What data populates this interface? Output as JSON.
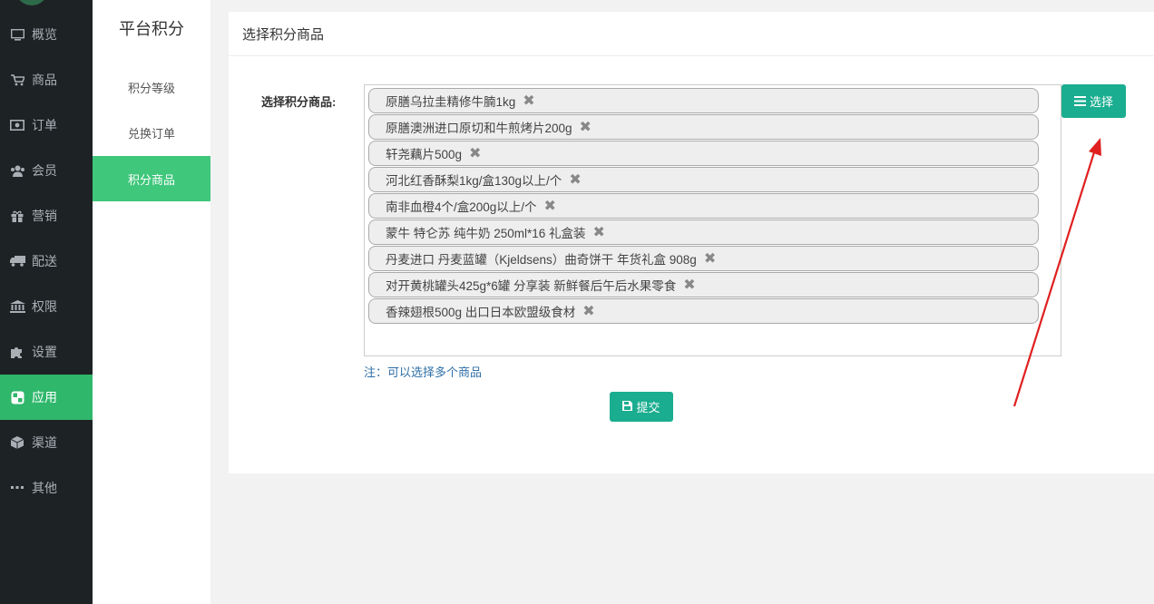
{
  "nav": {
    "items": [
      {
        "icon": "monitor-icon",
        "label": "概览"
      },
      {
        "icon": "cart-icon",
        "label": "商品"
      },
      {
        "icon": "money-icon",
        "label": "订单"
      },
      {
        "icon": "users-icon",
        "label": "会员"
      },
      {
        "icon": "gift-icon",
        "label": "营销"
      },
      {
        "icon": "truck-icon",
        "label": "配送"
      },
      {
        "icon": "bank-icon",
        "label": "权限"
      },
      {
        "icon": "puzzle-icon",
        "label": "设置"
      },
      {
        "icon": "apps-icon",
        "label": "应用",
        "active": true
      },
      {
        "icon": "cube-icon",
        "label": "渠道"
      },
      {
        "icon": "more-icon",
        "label": "其他"
      }
    ]
  },
  "subnav": {
    "title": "平台积分",
    "items": [
      {
        "label": "积分等级"
      },
      {
        "label": "兑换订单"
      },
      {
        "label": "积分商品",
        "active": true
      }
    ]
  },
  "panel": {
    "title": "选择积分商品",
    "field_label": "选择积分商品:",
    "choose_label": "选择",
    "note": "注：可以选择多个商品",
    "submit_label": "提交",
    "goods": [
      "原膳乌拉圭精修牛腩1kg",
      "原膳澳洲进口原切和牛煎烤片200g",
      "轩尧藕片500g",
      "河北红香酥梨1kg/盒130g以上/个",
      "南非血橙4个/盒200g以上/个",
      "蒙牛 特仑苏 纯牛奶 250ml*16 礼盒装",
      "丹麦进口 丹麦蓝罐（Kjeldsens）曲奇饼干 年货礼盒 908g",
      "对开黄桃罐头425g*6罐 分享装 新鲜餐后午后水果零食",
      "香辣翅根500g 出口日本欧盟级食材"
    ]
  },
  "colors": {
    "sidebar_bg": "#1d2225",
    "nav_active": "#2fb76b",
    "subnav_active": "#3fc77b",
    "button": "#1aad8f",
    "annotation_arrow": "#e02020"
  }
}
